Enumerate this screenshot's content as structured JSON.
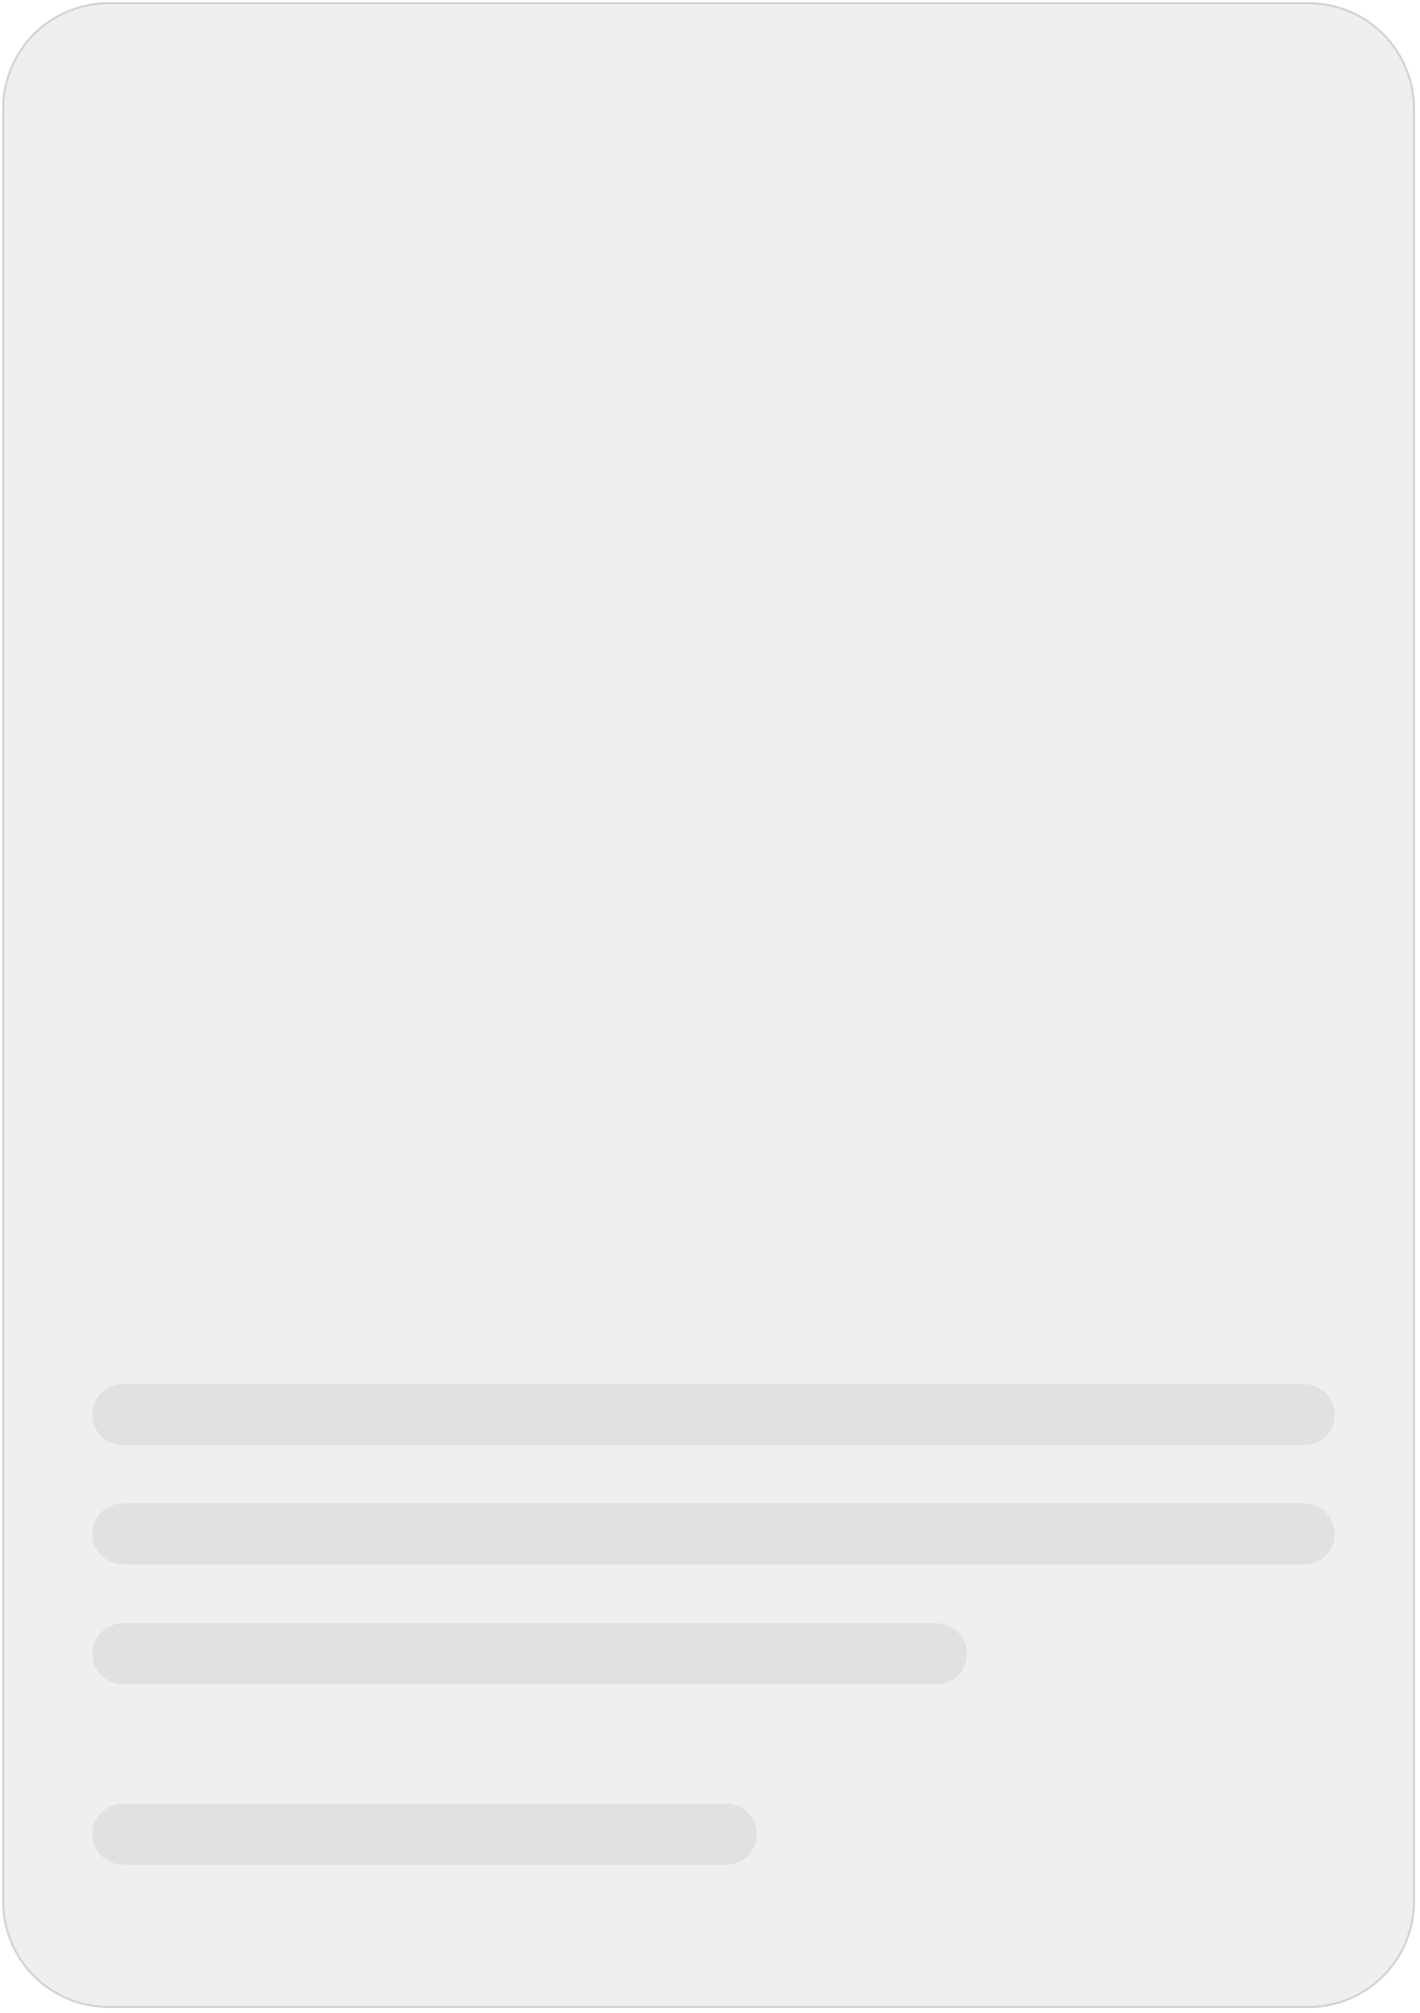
{
  "card": {
    "background": "#efeff1",
    "border_color": "#d4d4d6",
    "placeholder_color": "#e1e1e3"
  }
}
